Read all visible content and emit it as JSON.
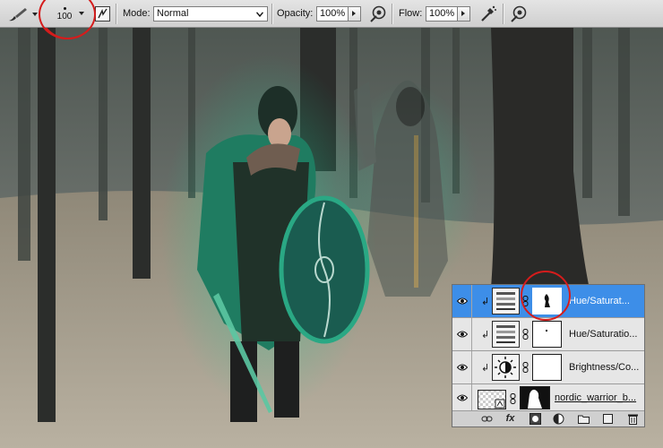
{
  "options_bar": {
    "tool": "brush-icon",
    "brush_size": "100",
    "mode_label": "Mode:",
    "mode_value": "Normal",
    "opacity_label": "Opacity:",
    "opacity_value": "100%",
    "flow_label": "Flow:",
    "flow_value": "100%"
  },
  "layers_panel": {
    "layers": [
      {
        "name": "Hue/Saturat...",
        "type": "adjustment",
        "adjustment_icon": "hue-saturation-icon",
        "selected": true,
        "visible": true
      },
      {
        "name": "Hue/Saturatio...",
        "type": "adjustment",
        "adjustment_icon": "hue-saturation-icon",
        "selected": false,
        "visible": true
      },
      {
        "name": "Brightness/Co...",
        "type": "adjustment",
        "adjustment_icon": "brightness-contrast-icon",
        "selected": false,
        "visible": true
      },
      {
        "name": "nordic_warrior_b...",
        "type": "smart-object",
        "selected": false,
        "visible": true
      }
    ],
    "footer_icons": [
      "link-layers-icon",
      "fx-icon",
      "add-mask-icon",
      "new-adjustment-icon",
      "new-group-icon",
      "new-layer-icon",
      "trash-icon"
    ],
    "fx_label": "fx"
  },
  "annotations": {
    "color": "#d51c1c"
  },
  "colors": {
    "selection": "#3d8ee8",
    "aura": "#1bbf8a"
  }
}
